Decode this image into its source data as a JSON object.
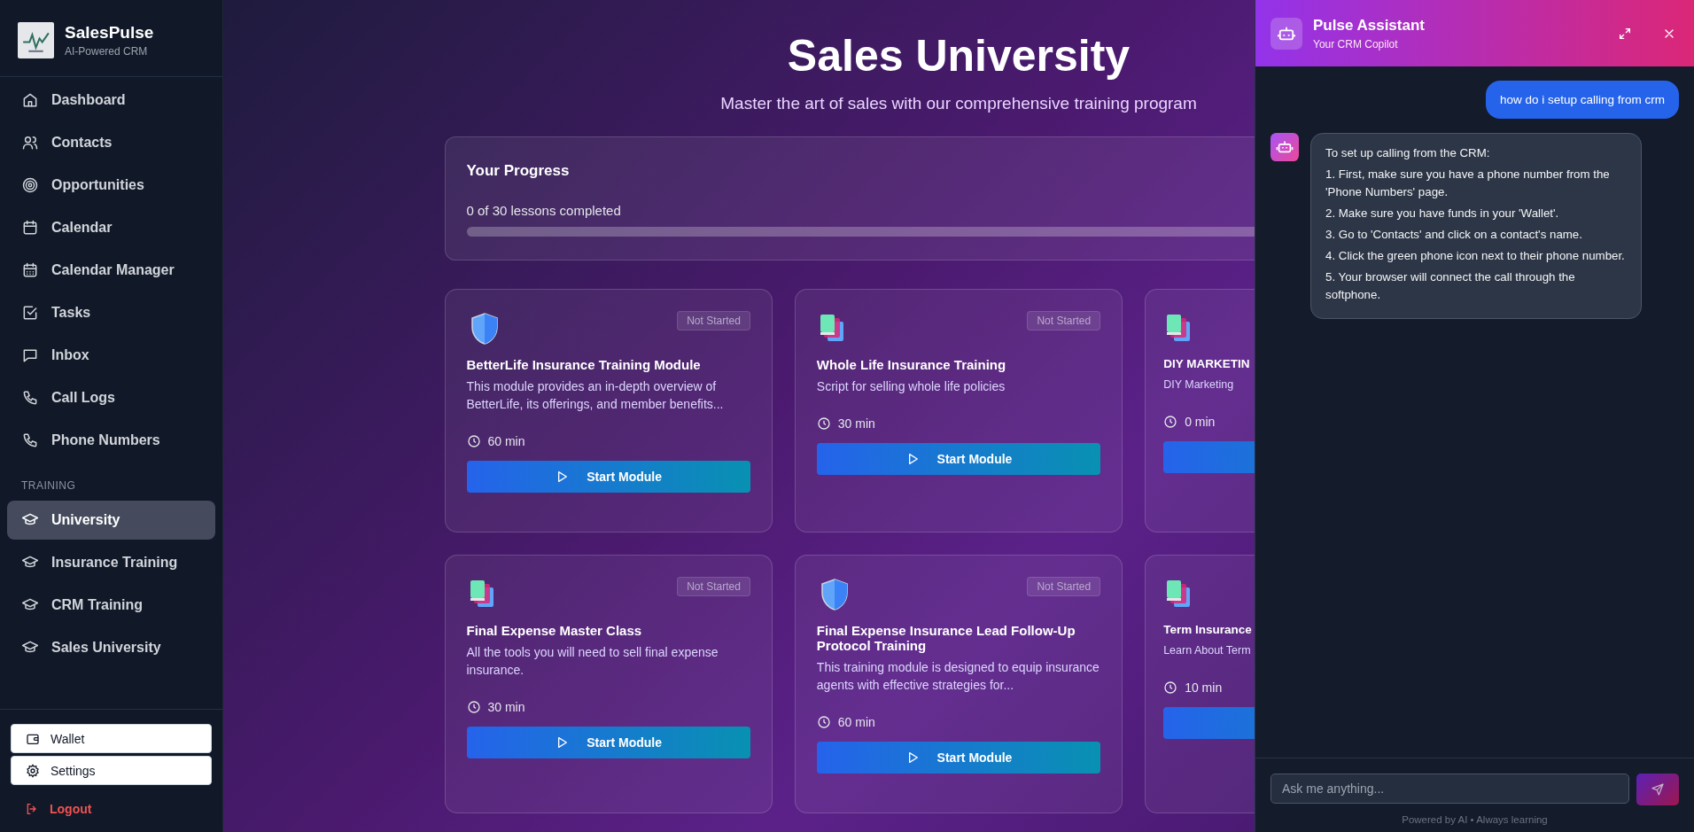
{
  "brand": {
    "name": "SalesPulse",
    "tagline": "AI-Powered CRM"
  },
  "nav": [
    {
      "label": "Dashboard",
      "selected": false
    },
    {
      "label": "Contacts",
      "selected": false
    },
    {
      "label": "Opportunities",
      "selected": false
    },
    {
      "label": "Calendar",
      "selected": false
    },
    {
      "label": "Calendar Manager",
      "selected": false
    },
    {
      "label": "Tasks",
      "selected": false
    },
    {
      "label": "Inbox",
      "selected": false
    },
    {
      "label": "Call Logs",
      "selected": false
    },
    {
      "label": "Phone Numbers",
      "selected": false
    }
  ],
  "training_heading": "TRAINING",
  "training": [
    {
      "label": "University",
      "selected": true
    },
    {
      "label": "Insurance Training",
      "selected": false
    },
    {
      "label": "CRM Training",
      "selected": false
    },
    {
      "label": "Sales University",
      "selected": false
    }
  ],
  "bottom_buttons": [
    "Wallet",
    "Settings"
  ],
  "logout": "Logout",
  "page": {
    "title": "Sales University",
    "subtitle": "Master the art of sales with our comprehensive training program"
  },
  "progress": {
    "title": "Your Progress",
    "summary": "0 of 30 lessons completed",
    "level": 0
  },
  "modules": [
    {
      "kind": "shield",
      "status": "Not Started",
      "title": "BetterLife Insurance Training Module",
      "description": "This module provides an in-depth overview of BetterLife, its offerings, and member benefits...",
      "duration": "60 min",
      "button": "Start Module"
    },
    {
      "kind": "books",
      "status": "Not Started",
      "title": "Whole Life Insurance Training",
      "description": "Script for selling whole life policies",
      "duration": "30 min",
      "button": "Start Module"
    },
    {
      "kind": "books",
      "title": "DIY MARKETIN",
      "description": "DIY Marketing",
      "duration": "0 min"
    },
    {
      "kind": "books",
      "status": "Not Started",
      "title": "Final Expense Master Class",
      "description": "All the tools you will need to sell final expense insurance.",
      "duration": "30 min",
      "button": "Start Module"
    },
    {
      "kind": "shield",
      "status": "Not Started",
      "title": "Final Expense Insurance Lead Follow-Up Protocol Training",
      "description": "This training module is designed to equip insurance agents with effective strategies for...",
      "duration": "60 min",
      "button": "Start Module"
    },
    {
      "kind": "books",
      "title": "Term Insurance",
      "description": "Learn About Term",
      "duration": "10 min"
    }
  ],
  "assistant": {
    "title": "Pulse Assistant",
    "subtitle": "Your CRM Copilot",
    "messages": [
      {
        "kind": "user",
        "text": "how do i setup calling from crm"
      },
      {
        "kind": "bot",
        "lines": [
          "To set up calling from the CRM:",
          "1. First, make sure you have a phone number from the 'Phone Numbers' page.",
          "2. Make sure you have funds in your 'Wallet'.",
          "3. Go to 'Contacts' and click on a contact's name.",
          "4. Click the green phone icon next to their phone number.",
          "5. Your browser will connect the call through the softphone."
        ]
      }
    ],
    "placeholder": "Ask me anything...",
    "footer": "Powered by AI • Always learning"
  }
}
